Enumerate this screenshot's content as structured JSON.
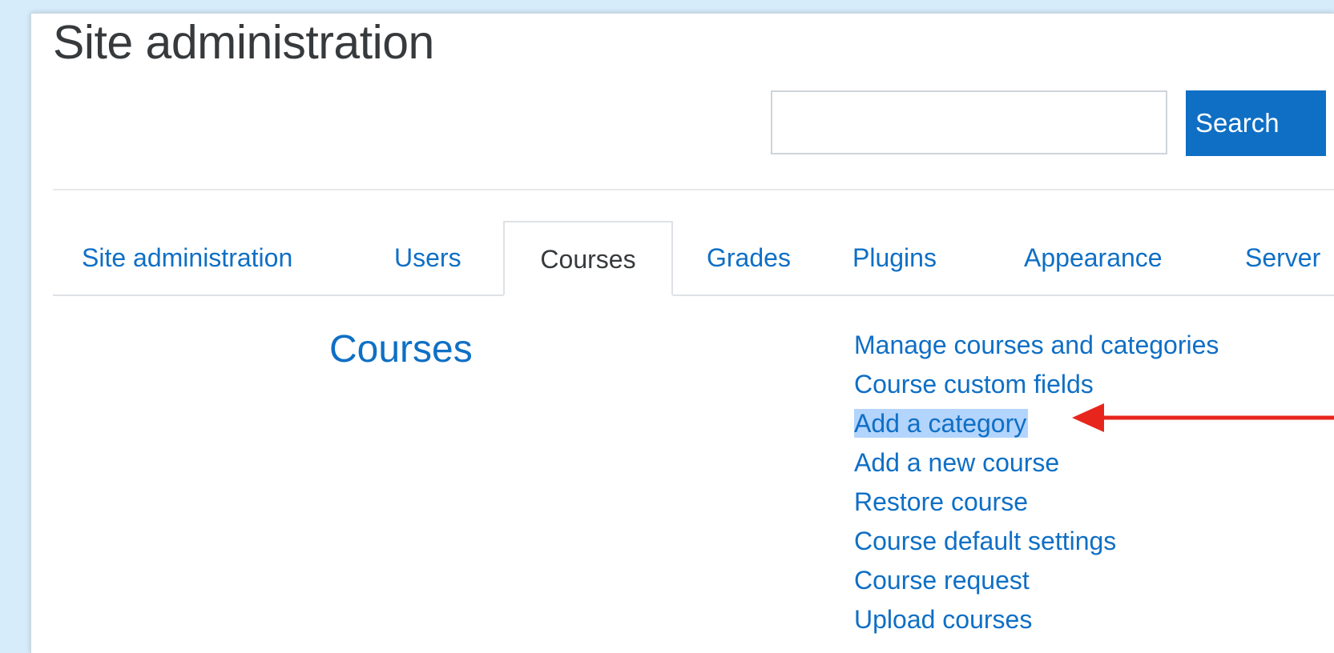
{
  "page": {
    "title": "Site administration"
  },
  "search": {
    "value": "",
    "placeholder": "",
    "button_label": "Search"
  },
  "tabs": [
    {
      "label": "Site administration",
      "active": false
    },
    {
      "label": "Users",
      "active": false
    },
    {
      "label": "Courses",
      "active": true
    },
    {
      "label": "Grades",
      "active": false
    },
    {
      "label": "Plugins",
      "active": false
    },
    {
      "label": "Appearance",
      "active": false
    },
    {
      "label": "Server",
      "active": false
    }
  ],
  "section": {
    "heading": "Courses",
    "links": [
      {
        "label": "Manage courses and categories",
        "highlighted": false
      },
      {
        "label": "Course custom fields",
        "highlighted": false
      },
      {
        "label": "Add a category",
        "highlighted": true
      },
      {
        "label": "Add a new course",
        "highlighted": false
      },
      {
        "label": "Restore course",
        "highlighted": false
      },
      {
        "label": "Course default settings",
        "highlighted": false
      },
      {
        "label": "Course request",
        "highlighted": false
      },
      {
        "label": "Upload courses",
        "highlighted": false
      }
    ]
  },
  "annotation": {
    "arrow_icon": "left-arrow-icon",
    "arrow_color": "#e8251c"
  },
  "colors": {
    "background": "#d6ecfb",
    "link": "#0f6fc5",
    "primary_button": "#0f6fc5",
    "text": "#373a3c",
    "highlight": "#b3d4fc"
  }
}
